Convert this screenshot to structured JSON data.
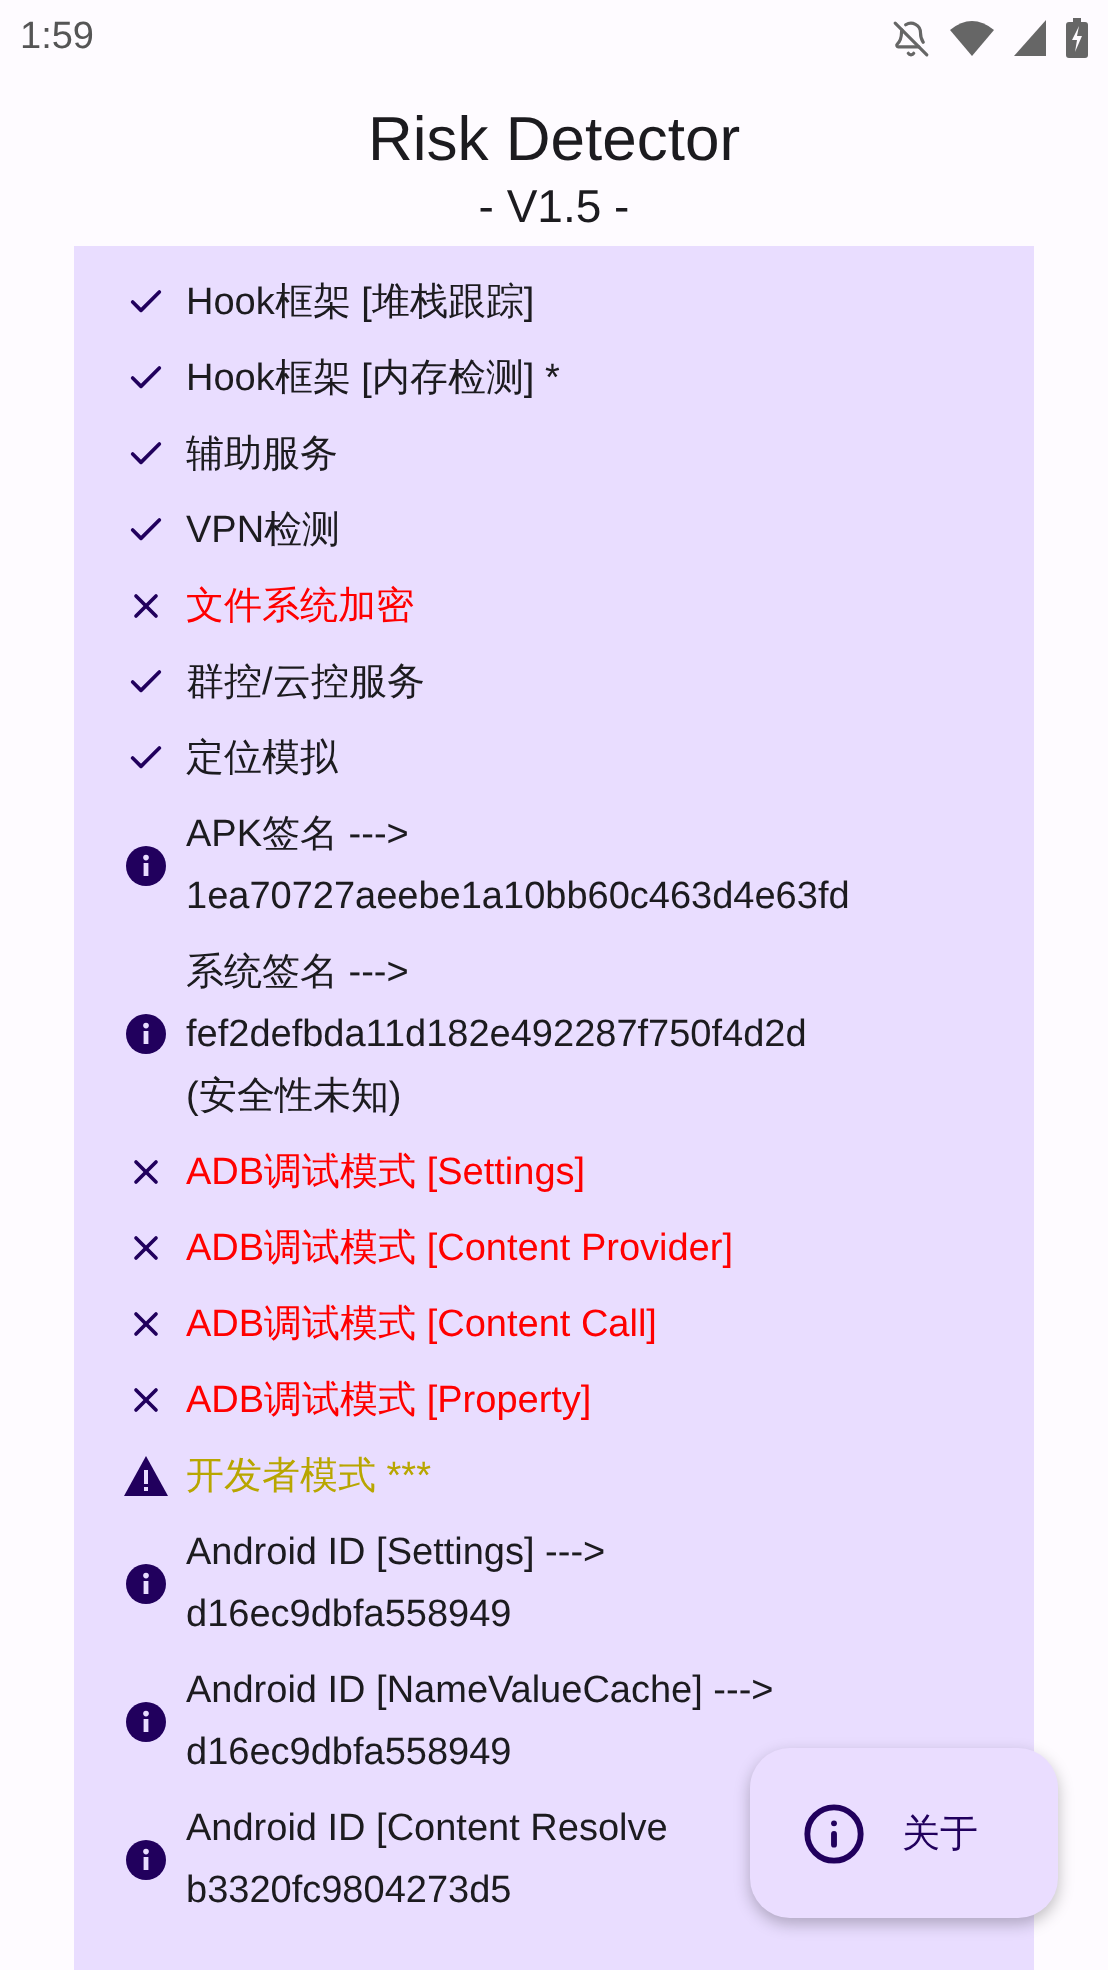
{
  "status_bar": {
    "time": "1:59"
  },
  "header": {
    "title": "Risk Detector",
    "version": "- V1.5 -"
  },
  "results": [
    {
      "kind": "pass",
      "lines": [
        "Hook框架 [堆栈跟踪]"
      ]
    },
    {
      "kind": "pass",
      "lines": [
        "Hook框架 [内存检测] *"
      ]
    },
    {
      "kind": "pass",
      "lines": [
        "辅助服务"
      ]
    },
    {
      "kind": "pass",
      "lines": [
        "VPN检测"
      ]
    },
    {
      "kind": "fail",
      "lines": [
        "文件系统加密"
      ]
    },
    {
      "kind": "pass",
      "lines": [
        "群控/云控服务"
      ]
    },
    {
      "kind": "pass",
      "lines": [
        "定位模拟"
      ]
    },
    {
      "kind": "info",
      "lines": [
        "APK签名 --->",
        "1ea70727aeebe1a10bb60c463d4e63fd"
      ]
    },
    {
      "kind": "info",
      "lines": [
        "系统签名 --->",
        "fef2defbda11d182e492287f750f4d2d",
        "(安全性未知)"
      ]
    },
    {
      "kind": "fail",
      "lines": [
        "ADB调试模式 [Settings]"
      ]
    },
    {
      "kind": "fail",
      "lines": [
        "ADB调试模式 [Content Provider]"
      ]
    },
    {
      "kind": "fail",
      "lines": [
        "ADB调试模式 [Content Call]"
      ]
    },
    {
      "kind": "fail",
      "lines": [
        "ADB调试模式 [Property]"
      ]
    },
    {
      "kind": "warn",
      "lines": [
        "开发者模式 ***"
      ]
    },
    {
      "kind": "info",
      "lines": [
        "Android ID [Settings] --->",
        "d16ec9dbfa558949"
      ]
    },
    {
      "kind": "info",
      "lines": [
        "Android ID [NameValueCache] --->",
        "d16ec9dbfa558949"
      ]
    },
    {
      "kind": "info",
      "lines": [
        "Android ID [Content Resolve",
        "b3320fc9804273d5"
      ]
    }
  ],
  "fab": {
    "label": "关于"
  }
}
